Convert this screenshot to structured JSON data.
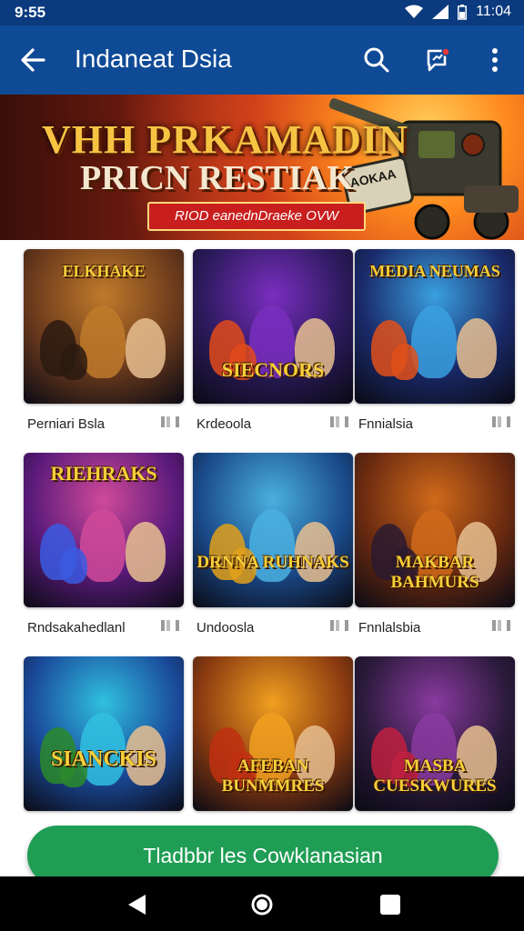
{
  "status_bar": {
    "time": "9:55",
    "clock": "11:04",
    "icons": [
      "wifi-icon",
      "signal-icon",
      "battery-icon"
    ]
  },
  "app_bar": {
    "title": "Indaneat Dsia",
    "icons": [
      "back-arrow-icon",
      "search-icon",
      "chat-notification-icon",
      "more-vert-icon"
    ]
  },
  "banner": {
    "title": "VHH PRKAMADIN",
    "subtitle": "PRICN RESTIAK",
    "ribbon": "RIOD eanednDraeke OVW",
    "sign": "AOKAA"
  },
  "games": [
    {
      "label": "Perniari Bsla",
      "art": "ELKHAKE",
      "palette": [
        "#6b3a1c",
        "#c07a2a",
        "#2a1a10"
      ]
    },
    {
      "label": "Krdeoola",
      "art": "SIECNORS",
      "palette": [
        "#2a1a5a",
        "#7a2ec0",
        "#e04a1a"
      ]
    },
    {
      "label": "Fnnialsia",
      "art": "MEDIA NEUMAS",
      "palette": [
        "#1a2a6a",
        "#3aa0e0",
        "#e0501a"
      ]
    },
    {
      "label": "Rndsakahedlanl",
      "art": "RIEHRAKS",
      "palette": [
        "#5a1a7a",
        "#d04a9a",
        "#3a5ae0"
      ]
    },
    {
      "label": "Undoosla",
      "art": "DRNNA RUHNAKS",
      "palette": [
        "#1a4a8a",
        "#4ab0e0",
        "#e0a01a"
      ]
    },
    {
      "label": "Fnnlalsbia",
      "art": "MAKBAR BAHMURS",
      "palette": [
        "#6a2a10",
        "#d06a1a",
        "#2a1a30"
      ]
    },
    {
      "label": "",
      "art": "SIANCKIS",
      "palette": [
        "#1a4a9a",
        "#30c0e0",
        "#2a8a2a"
      ]
    },
    {
      "label": "",
      "art": "AFEBAN BUNMMRES",
      "palette": [
        "#8a3a10",
        "#f0a020",
        "#c03010"
      ]
    },
    {
      "label": "",
      "art": "MASBA CUESKWURES",
      "palette": [
        "#2a1a3a",
        "#8a3aa0",
        "#c02040"
      ]
    }
  ],
  "cta": {
    "label": "Tladbbr les Cowklanasian"
  },
  "nav": {
    "icons": [
      "nav-back-icon",
      "nav-home-icon",
      "nav-recents-icon"
    ]
  },
  "colors": {
    "status_bar": "#0b3a7e",
    "app_bar": "#0f4a96",
    "cta": "#1f9d55",
    "banner_title": "#f6c343"
  }
}
